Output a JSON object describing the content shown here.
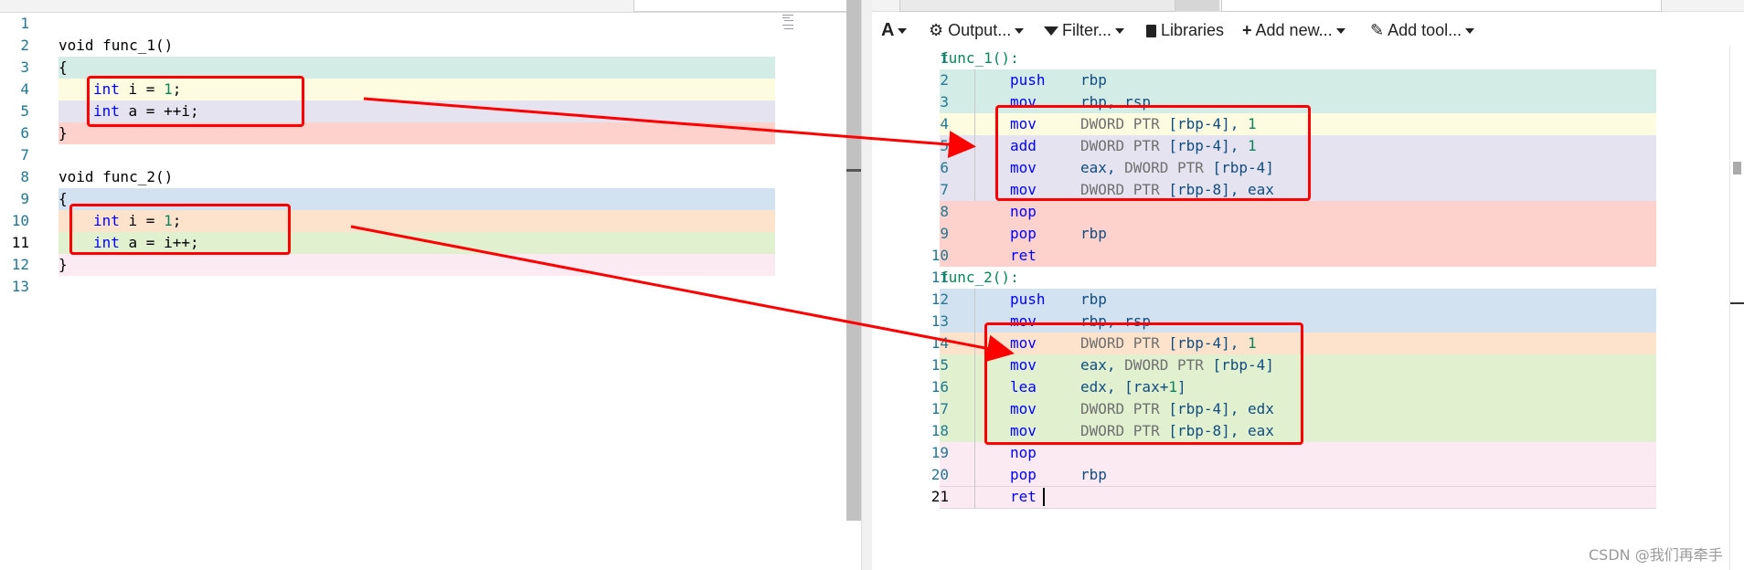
{
  "source": {
    "lines": [
      {
        "n": "1",
        "code": ""
      },
      {
        "n": "2",
        "code": "void func_1()"
      },
      {
        "n": "3",
        "code": "{"
      },
      {
        "n": "4",
        "kw": "int",
        "rest": " i = ",
        "num": "1",
        "tail": ";"
      },
      {
        "n": "5",
        "kw": "int",
        "rest": " a = ++i;",
        "num": "",
        "tail": ""
      },
      {
        "n": "6",
        "code": "}"
      },
      {
        "n": "7",
        "code": ""
      },
      {
        "n": "8",
        "code": "void func_2()"
      },
      {
        "n": "9",
        "code": "{"
      },
      {
        "n": "10",
        "kw": "int",
        "rest": " i = ",
        "num": "1",
        "tail": ";"
      },
      {
        "n": "11",
        "kw": "int",
        "rest": " a = i++;",
        "num": "",
        "tail": ""
      },
      {
        "n": "12",
        "code": "}"
      },
      {
        "n": "13",
        "code": ""
      }
    ]
  },
  "toolbar": {
    "font_button": "A",
    "output_label": "Output...",
    "filter_label": "Filter...",
    "libraries_label": "Libraries",
    "add_new_label": "Add new...",
    "add_tool_label": "Add tool..."
  },
  "assembly": {
    "lines": [
      {
        "n": "1",
        "label": "func_1():"
      },
      {
        "n": "2",
        "op": "push",
        "args": [
          {
            "t": "rbp",
            "c": "reg"
          }
        ]
      },
      {
        "n": "3",
        "op": "mov",
        "args": [
          {
            "t": "rbp, rsp",
            "c": "reg"
          }
        ]
      },
      {
        "n": "4",
        "op": "mov",
        "args": [
          {
            "t": "DWORD PTR ",
            "c": "ptr"
          },
          {
            "t": "[rbp-4], ",
            "c": "reg"
          },
          {
            "t": "1",
            "c": "num"
          }
        ]
      },
      {
        "n": "5",
        "op": "add",
        "args": [
          {
            "t": "DWORD PTR ",
            "c": "ptr"
          },
          {
            "t": "[rbp-4], ",
            "c": "reg"
          },
          {
            "t": "1",
            "c": "num"
          }
        ]
      },
      {
        "n": "6",
        "op": "mov",
        "args": [
          {
            "t": "eax, ",
            "c": "reg"
          },
          {
            "t": "DWORD PTR ",
            "c": "ptr"
          },
          {
            "t": "[rbp-4]",
            "c": "reg"
          }
        ]
      },
      {
        "n": "7",
        "op": "mov",
        "args": [
          {
            "t": "DWORD PTR ",
            "c": "ptr"
          },
          {
            "t": "[rbp-8], eax",
            "c": "reg"
          }
        ]
      },
      {
        "n": "8",
        "op": "nop",
        "args": []
      },
      {
        "n": "9",
        "op": "pop",
        "args": [
          {
            "t": "rbp",
            "c": "reg"
          }
        ]
      },
      {
        "n": "10",
        "op": "ret",
        "args": []
      },
      {
        "n": "11",
        "label": "func_2():"
      },
      {
        "n": "12",
        "op": "push",
        "args": [
          {
            "t": "rbp",
            "c": "reg"
          }
        ]
      },
      {
        "n": "13",
        "op": "mov",
        "args": [
          {
            "t": "rbp, rsp",
            "c": "reg"
          }
        ]
      },
      {
        "n": "14",
        "op": "mov",
        "args": [
          {
            "t": "DWORD PTR ",
            "c": "ptr"
          },
          {
            "t": "[rbp-4], ",
            "c": "reg"
          },
          {
            "t": "1",
            "c": "num"
          }
        ]
      },
      {
        "n": "15",
        "op": "mov",
        "args": [
          {
            "t": "eax, ",
            "c": "reg"
          },
          {
            "t": "DWORD PTR ",
            "c": "ptr"
          },
          {
            "t": "[rbp-4]",
            "c": "reg"
          }
        ]
      },
      {
        "n": "16",
        "op": "lea",
        "args": [
          {
            "t": "edx, [rax+",
            "c": "reg"
          },
          {
            "t": "1",
            "c": "num"
          },
          {
            "t": "]",
            "c": "reg"
          }
        ]
      },
      {
        "n": "17",
        "op": "mov",
        "args": [
          {
            "t": "DWORD PTR ",
            "c": "ptr"
          },
          {
            "t": "[rbp-4], edx",
            "c": "reg"
          }
        ]
      },
      {
        "n": "18",
        "op": "mov",
        "args": [
          {
            "t": "DWORD PTR ",
            "c": "ptr"
          },
          {
            "t": "[rbp-8], eax",
            "c": "reg"
          }
        ]
      },
      {
        "n": "19",
        "op": "nop",
        "args": []
      },
      {
        "n": "20",
        "op": "pop",
        "args": [
          {
            "t": "rbp",
            "c": "reg"
          }
        ]
      },
      {
        "n": "21",
        "op": "ret",
        "args": []
      }
    ]
  },
  "colors": {
    "line_highlights": [
      "#d4ece6",
      "#fdfbe0",
      "#e6e3f0",
      "#fdd2cc",
      "#d3e2f0",
      "#fde3cc",
      "#e1f0cf",
      "#fceaf2"
    ],
    "annotation_red": "#ff0000",
    "keyword_blue": "#0000ff",
    "number_green": "#098658",
    "line_number": "#237893"
  },
  "watermark": "CSDN @我们再牵手"
}
